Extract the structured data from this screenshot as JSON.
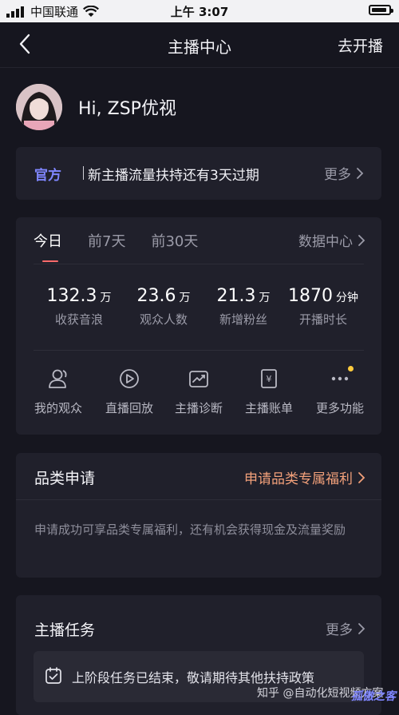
{
  "status_bar": {
    "carrier": "中国联通",
    "time": "上午 3:07",
    "icons": [
      "signal-icon",
      "wifi-icon",
      "battery-icon"
    ]
  },
  "nav": {
    "title": "主播中心",
    "action": "去开播"
  },
  "profile": {
    "greeting": "Hi, ZSP优视"
  },
  "notice": {
    "tag": "官方",
    "text": "新主播流量扶持还有3天过期",
    "more": "更多"
  },
  "stats": {
    "tabs": [
      "今日",
      "前7天",
      "前30天"
    ],
    "active_tab": "今日",
    "data_center": "数据中心",
    "metrics": [
      {
        "value": "132.3",
        "unit": "万",
        "label": "收获音浪"
      },
      {
        "value": "23.6",
        "unit": "万",
        "label": "观众人数"
      },
      {
        "value": "21.3",
        "unit": "万",
        "label": "新增粉丝"
      },
      {
        "value": "1870",
        "unit": "分钟",
        "label": "开播时长"
      }
    ],
    "shortcuts": [
      {
        "label": "我的观众",
        "icon": "audience-icon"
      },
      {
        "label": "直播回放",
        "icon": "replay-icon"
      },
      {
        "label": "主播诊断",
        "icon": "diagnosis-icon"
      },
      {
        "label": "主播账单",
        "icon": "bill-icon"
      },
      {
        "label": "更多功能",
        "icon": "more-dots-icon"
      }
    ]
  },
  "category": {
    "title": "品类申请",
    "link": "申请品类专属福利",
    "desc": "申请成功可享品类专属福利，还有机会获得现金及流量奖励"
  },
  "tasks": {
    "title": "主播任务",
    "more": "更多",
    "message": "上阶段任务已结束，敬请期待其他扶持政策"
  },
  "watermark": {
    "text": "知乎 @自动化短视频方案",
    "corner": "孤傲之客"
  },
  "colors": {
    "background": "#16161f",
    "card": "#20202b",
    "accent_blue": "#7f86ff",
    "accent_orange": "#f2a07a",
    "tab_underline": "#ff6a6a",
    "notification_dot": "#ffcb3d"
  }
}
